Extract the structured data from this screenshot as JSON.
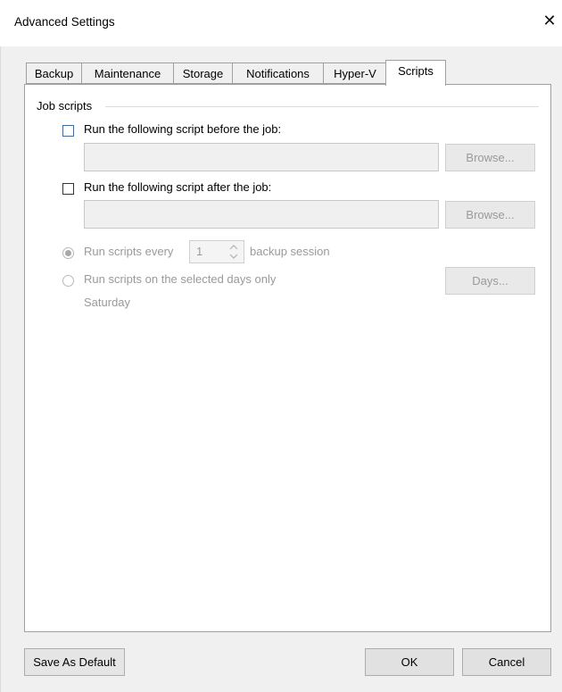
{
  "window": {
    "title": "Advanced Settings",
    "close_glyph": "✕"
  },
  "tabs": [
    {
      "label": "Backup"
    },
    {
      "label": "Maintenance"
    },
    {
      "label": "Storage"
    },
    {
      "label": "Notifications"
    },
    {
      "label": "Hyper-V"
    },
    {
      "label": "Scripts",
      "active": true
    }
  ],
  "scripts": {
    "group_label": "Job scripts",
    "before_label": "Run the following script before the job:",
    "before_checked": false,
    "before_path": "",
    "after_label": "Run the following script after the job:",
    "after_checked": false,
    "after_path": "",
    "browse_label": "Browse...",
    "run_every_prefix": "Run scripts every",
    "run_every_value": "1",
    "run_every_suffix": "backup session",
    "run_days_label": "Run scripts on the selected days only",
    "days_button": "Days...",
    "selected_days": "Saturday"
  },
  "footer": {
    "save_default": "Save As Default",
    "ok": "OK",
    "cancel": "Cancel"
  }
}
